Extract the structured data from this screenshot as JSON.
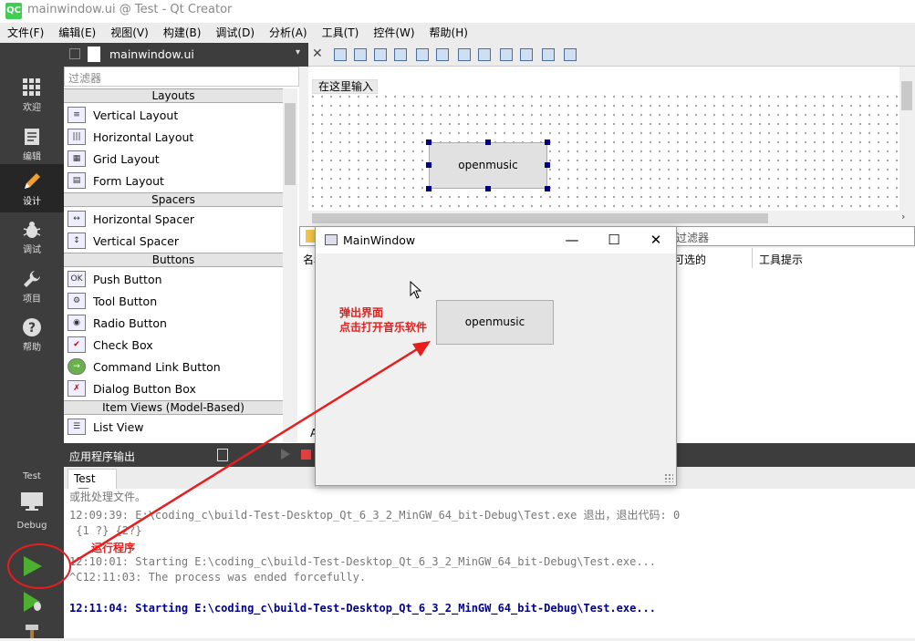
{
  "window": {
    "title": "mainwindow.ui @ Test - Qt Creator",
    "logo": "QC"
  },
  "menubar": [
    "文件(F)",
    "编辑(E)",
    "视图(V)",
    "构建(B)",
    "调试(D)",
    "分析(A)",
    "工具(T)",
    "控件(W)",
    "帮助(H)"
  ],
  "modebar": {
    "items": [
      {
        "label": "欢迎",
        "icon": "grid-icon"
      },
      {
        "label": "编辑",
        "icon": "document-icon"
      },
      {
        "label": "设计",
        "icon": "pencil-icon"
      },
      {
        "label": "调试",
        "icon": "bug-icon"
      },
      {
        "label": "项目",
        "icon": "wrench-icon"
      },
      {
        "label": "帮助",
        "icon": "help-icon"
      }
    ],
    "kit_project": "Test",
    "kit_config": "Debug"
  },
  "document": {
    "tab": "mainwindow.ui"
  },
  "widgetbox": {
    "filter_placeholder": "过滤器",
    "categories": [
      "Layouts",
      "Spacers",
      "Buttons",
      "Item Views (Model-Based)"
    ],
    "layouts": [
      "Vertical Layout",
      "Horizontal Layout",
      "Grid Layout",
      "Form Layout"
    ],
    "spacers": [
      "Horizontal Spacer",
      "Vertical Spacer"
    ],
    "buttons": [
      "Push Button",
      "Tool Button",
      "Radio Button",
      "Check Box",
      "Command Link Button",
      "Dialog Button Box"
    ],
    "item_views": [
      "List View"
    ]
  },
  "form": {
    "menu_placeholder": "在这里输入",
    "button_text": "openmusic"
  },
  "signals": {
    "filter_placeholder": "过滤器",
    "columns": [
      "名称",
      "可选的",
      "工具提示"
    ],
    "partial_text": "A"
  },
  "output": {
    "pane_title": "应用程序输出",
    "tab": "Test",
    "lines": [
      "或批处理文件。",
      "12:09:39: E:\\coding_c\\build-Test-Desktop_Qt_6_3_2_MinGW_64_bit-Debug\\Test.exe 退出，退出代码: 0",
      " {1 ?} {2?}",
      "12:10:01: Starting E:\\coding_c\\build-Test-Desktop_Qt_6_3_2_MinGW_64_bit-Debug\\Test.exe...",
      "^C12:11:03: The process was ended forcefully.",
      "12:11:04: Starting E:\\coding_c\\build-Test-Desktop_Qt_6_3_2_MinGW_64_bit-Debug\\Test.exe..."
    ]
  },
  "app_window": {
    "title": "MainWindow",
    "button_text": "openmusic"
  },
  "annotations": {
    "popup_line1": "弹出界面",
    "popup_line2": "点击打开音乐软件",
    "run": "运行程序"
  },
  "colors": {
    "annotation": "#e81e1e",
    "modebar": "#3d3d3d",
    "selection_handle": "#00007f",
    "run_button": "#4caf2f"
  }
}
